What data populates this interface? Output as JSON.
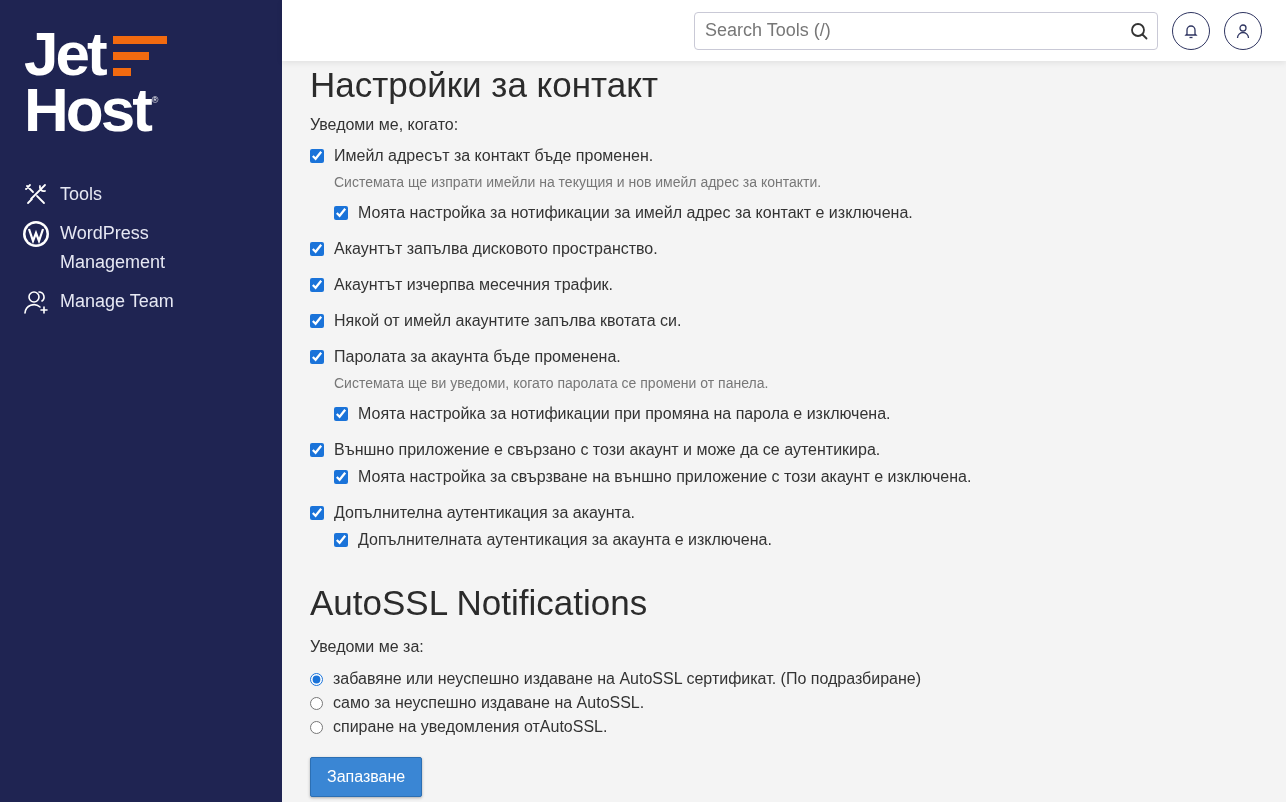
{
  "logo": {
    "line_1": "Jet",
    "line_2": "Host",
    "mark": "®"
  },
  "sidebar": {
    "items": [
      {
        "kind": "tools",
        "label": "Tools",
        "selected": false
      },
      {
        "kind": "wordpress",
        "label": "WordPress Management",
        "selected": false
      },
      {
        "kind": "team",
        "label": "Manage Team",
        "selected": false
      }
    ]
  },
  "header": {
    "search": {
      "placeholder": "Search Tools (/)"
    }
  },
  "contact": {
    "title": "Настройки за контакт",
    "intro": "Уведоми ме, когато:",
    "options": [
      {
        "label": "Имейл адресът за контакт бъде променен.",
        "checked": true,
        "note": "Системата ще изпрати имейли на текущия и нов имейл адрес за контакти.",
        "children": [
          {
            "label": "Моята настройка за нотификации за имейл адрес за контакт е изключена.",
            "checked": true
          }
        ]
      },
      {
        "label": "Акаунтът запълва дисковото пространство.",
        "checked": true
      },
      {
        "label": "Акаунтът изчерпва месечния трафик.",
        "checked": true
      },
      {
        "label": "Някой от имейл акаунтите запълва квотата си.",
        "checked": true
      },
      {
        "label": "Паролата за акаунта бъде променена.",
        "checked": true,
        "note": "Системата ще ви уведоми, когато паролата се промени от панела.",
        "children": [
          {
            "label": "Моята настройка за нотификации при промяна на парола е изключена.",
            "checked": true
          }
        ]
      },
      {
        "label": "Външно приложение е свързано с този акаунт и може да се аутентикира.",
        "checked": true,
        "children": [
          {
            "label": "Моята настройка за свързване на външно приложение с този акаунт е изключена.",
            "checked": true
          }
        ]
      },
      {
        "label": "Допълнителна аутентикация за акаунта.",
        "checked": true,
        "children": [
          {
            "label": "Допълнителната аутентикация за акаунта е изключена.",
            "checked": true
          }
        ]
      }
    ]
  },
  "autossl": {
    "title": "AutoSSL Notifications",
    "intro": "Уведоми ме за:",
    "options": [
      {
        "label": "забавяне или неуспешно издаване на AutoSSL сертификат. (По подразбиране)",
        "selected": true
      },
      {
        "label": "само за неуспешно издаване на AutoSSL.",
        "selected": false
      },
      {
        "label": "спиране на уведомления отAutoSSL.",
        "selected": false
      }
    ]
  },
  "save_button": "Запазване"
}
